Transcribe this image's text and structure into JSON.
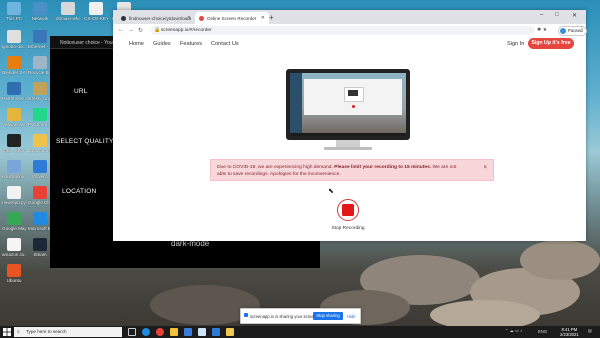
{
  "desktop": {
    "icons": [
      {
        "label": "This PC",
        "color": "#6fb3e0"
      },
      {
        "label": "Network",
        "color": "#4a8fc9"
      },
      {
        "label": "domain-who...",
        "color": "#d8d8d8"
      },
      {
        "label": "CS-CE-KEYS...",
        "color": "#f0f0f0"
      },
      {
        "label": "Intel_USB_...",
        "color": "#e6e6e6"
      },
      {
        "label": "ignoba-doc...",
        "color": "#e0e0e0"
      },
      {
        "label": "Ethernet - Shortcut",
        "color": "#3a76b8"
      },
      {
        "label": "Blender 3.6",
        "color": "#e87d0d"
      },
      {
        "label": "Recycle Bin",
        "color": "#9fb6c8"
      },
      {
        "label": "Parrot-secur...",
        "color": "#2f6fb1"
      },
      {
        "label": "stresh_circle...",
        "color": "#bfa15a"
      },
      {
        "label": "VMware Workstation...",
        "color": "#e5b43a"
      },
      {
        "label": "PyCharm Commun...",
        "color": "#21d789"
      },
      {
        "label": "cmd - Shortcut",
        "color": "#222222"
      },
      {
        "label": "amazon.rec...",
        "color": "#efc24a"
      },
      {
        "label": "educational video...",
        "color": "#7aa5d8"
      },
      {
        "label": "Vs.ver...",
        "color": "#2c7bd6"
      },
      {
        "label": "newrepo.py",
        "color": "#f2f2f2"
      },
      {
        "label": "Google Chrome",
        "color": "#e94235"
      },
      {
        "label": "Google Maps",
        "color": "#34a853"
      },
      {
        "label": "Microsoft Edge",
        "color": "#1e8be0"
      },
      {
        "label": "amazon.cu...",
        "color": "#f5f5f5"
      },
      {
        "label": "Steam",
        "color": "#1b2838"
      },
      {
        "label": "Ubuntu",
        "color": "#e95420"
      }
    ]
  },
  "dark_app": {
    "title": "Noticeuser choice - Youtube Video Downloader",
    "labels": [
      "URL",
      "SELECT QUALITY",
      "LOCATION"
    ],
    "mode_label": "dark-mode"
  },
  "browser": {
    "tabs": [
      {
        "title": "findnouser-choice/ytdownloader",
        "active": false,
        "fav": "#333333"
      },
      {
        "title": "Online Screen Recorder",
        "active": true,
        "fav": "#e5463e"
      }
    ],
    "new_tab": "+",
    "url": "screenapp.io/#/recorder",
    "profile_label": "Paused",
    "controls": {
      "minimize": "–",
      "maximize": "□",
      "close": "✕"
    }
  },
  "site": {
    "nav": [
      "Home",
      "Guides",
      "Features",
      "Contact Us"
    ],
    "login": "Sign In",
    "signup": "Sign Up it's free",
    "notice_prefix": "Due to COVID-19, we are experiencing high demand. ",
    "notice_bold": "Please limit your recording to 15 minutes.",
    "notice_suffix": " We are not able to save recordings. Apologies for the inconvenience.",
    "notice_close": "×",
    "record_label": "Stop Recording"
  },
  "share_bar": {
    "message": "screenapp.io is sharing your screen",
    "stop": "Stop sharing",
    "hide": "Hide"
  },
  "taskbar": {
    "search_placeholder": "Type here to search",
    "time": "8:41 PM",
    "date": "2/23/2021",
    "lang": "ENG"
  }
}
